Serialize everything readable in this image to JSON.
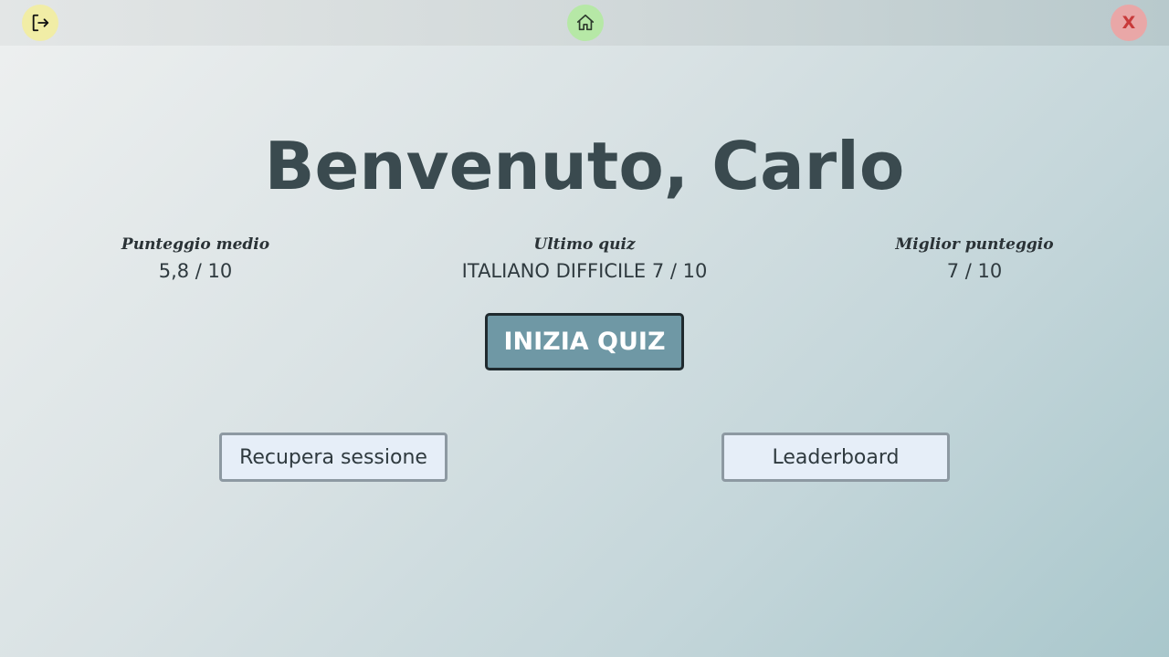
{
  "topbar": {
    "close_label": "X",
    "icons": {
      "logout": "logout-icon",
      "home": "home-icon"
    },
    "colors": {
      "logout_bg": "#f1eda6",
      "home_bg": "#b6e8a6",
      "close_bg": "#e9a7a7",
      "close_fg": "#c83a3a"
    }
  },
  "welcome": {
    "title": "Benvenuto, Carlo"
  },
  "stats": [
    {
      "label": "Punteggio medio",
      "value": "5,8 / 10"
    },
    {
      "label": "Ultimo quiz",
      "value": "ITALIANO DIFFICILE 7 / 10"
    },
    {
      "label": "Miglior punteggio",
      "value": "7 / 10"
    }
  ],
  "actions": {
    "start_label": "INIZIA QUIZ",
    "recover_label": "Recupera sessione",
    "leaderboard_label": "Leaderboard"
  },
  "colors": {
    "accent": "#6f98a5",
    "title": "#3a4a4f",
    "secondary_button_bg": "#e6eef8"
  }
}
